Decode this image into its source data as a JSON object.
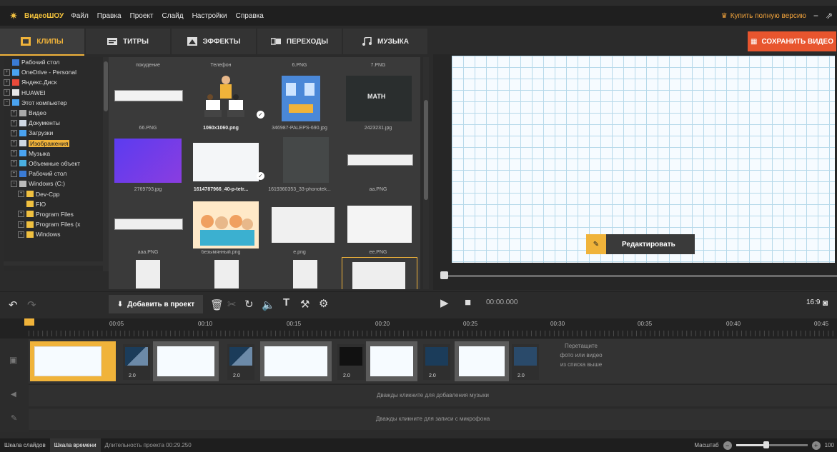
{
  "app": {
    "name": "ВидеоШОУ",
    "menu": [
      "Файл",
      "Правка",
      "Проект",
      "Слайд",
      "Настройки",
      "Справка"
    ],
    "buy_full": "Купить полную версию",
    "window_controls": [
      "−",
      "⇗"
    ]
  },
  "tabs": [
    {
      "label": "КЛИПЫ",
      "icon": "clips-icon",
      "active": true
    },
    {
      "label": "ТИТРЫ",
      "icon": "titles-icon",
      "active": false
    },
    {
      "label": "ЭФФЕКТЫ",
      "icon": "effects-icon",
      "active": false
    },
    {
      "label": "ПЕРЕХОДЫ",
      "icon": "transitions-icon",
      "active": false
    },
    {
      "label": "МУЗЫКА",
      "icon": "music-icon",
      "active": false
    }
  ],
  "save_video": "СОХРАНИТЬ ВИДЕО",
  "tree": [
    {
      "label": "Рабочий стол",
      "level": 0,
      "icon": "desktop",
      "expander": ""
    },
    {
      "label": "OneDrive - Personal",
      "level": 0,
      "icon": "cloud",
      "expander": "+"
    },
    {
      "label": "Яндекс.Диск",
      "level": 0,
      "icon": "disk",
      "expander": "+"
    },
    {
      "label": "HUAWEI",
      "level": 0,
      "icon": "user",
      "expander": "+"
    },
    {
      "label": "Этот компьютер",
      "level": 0,
      "icon": "computer",
      "expander": "−"
    },
    {
      "label": "Видео",
      "level": 1,
      "icon": "video",
      "expander": "+"
    },
    {
      "label": "Документы",
      "level": 1,
      "icon": "docs",
      "expander": "+"
    },
    {
      "label": "Загрузки",
      "level": 1,
      "icon": "download",
      "expander": "+"
    },
    {
      "label": "Изображения",
      "level": 1,
      "icon": "images",
      "expander": "+",
      "selected": true
    },
    {
      "label": "Музыка",
      "level": 1,
      "icon": "music",
      "expander": "+"
    },
    {
      "label": "Объемные объект",
      "level": 1,
      "icon": "3d",
      "expander": "+"
    },
    {
      "label": "Рабочий стол",
      "level": 1,
      "icon": "desktop",
      "expander": "+"
    },
    {
      "label": "Windows (C:)",
      "level": 1,
      "icon": "drive",
      "expander": "−"
    },
    {
      "label": "Dev-Cpp",
      "level": 2,
      "icon": "folder",
      "expander": "+"
    },
    {
      "label": "FIO",
      "level": 2,
      "icon": "folder",
      "expander": ""
    },
    {
      "label": "Program Files",
      "level": 2,
      "icon": "folder",
      "expander": "+"
    },
    {
      "label": "Program Files (x",
      "level": 2,
      "icon": "folder",
      "expander": "+"
    },
    {
      "label": "Windows",
      "level": 2,
      "icon": "folder",
      "expander": "+"
    }
  ],
  "gallery": {
    "top_captions": [
      "покудение",
      "Телефон",
      "6.PNG",
      "7.PNG"
    ],
    "items": [
      {
        "caption": "66.PNG",
        "bold": false
      },
      {
        "caption": "1060x1060.png",
        "bold": true
      },
      {
        "caption": "346987-PALEPS-690.jpg",
        "bold": false
      },
      {
        "caption": "2423231.jpg",
        "bold": false
      },
      {
        "caption": "2769793.jpg",
        "bold": false
      },
      {
        "caption": "1614787966_40-p-tetr...",
        "bold": true
      },
      {
        "caption": "1619360353_33-phonotek...",
        "bold": false
      },
      {
        "caption": "aa.PNG",
        "bold": false
      },
      {
        "caption": "aaa.PNG",
        "bold": false
      },
      {
        "caption": "безымянный.png",
        "bold": false
      },
      {
        "caption": "e.png",
        "bold": false
      },
      {
        "caption": "ee.PNG",
        "bold": false
      }
    ],
    "math_label": "MATH"
  },
  "preview": {
    "edit_button": "Редактировать"
  },
  "toolbar": {
    "add_to_project": "Добавить в проект",
    "timecode": "00:00.000",
    "aspect": "16:9"
  },
  "ruler": [
    "00:05",
    "00:10",
    "00:15",
    "00:20",
    "00:25",
    "00:30",
    "00:35",
    "00:40",
    "00:45"
  ],
  "timeline": {
    "transition_duration": "2.0",
    "drop_hint": [
      "Перетащите",
      "фото или видео",
      "из списка выше"
    ],
    "music_hint": "Дважды кликните для добавления музыки",
    "mic_hint": "Дважды кликните для записи с микрофона"
  },
  "status": {
    "slides_tab": "Шкала слайдов",
    "timeline_tab": "Шкала времени",
    "duration": "Длительность проекта 00:29.250",
    "zoom_label": "Масштаб",
    "zoom_value": "100"
  },
  "colors": {
    "accent": "#f0b33a",
    "save_button": "#e8552e"
  }
}
